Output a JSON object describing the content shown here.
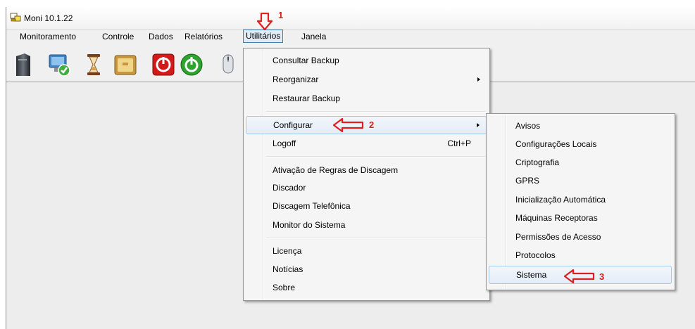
{
  "window": {
    "title": "Moni 10.1.22"
  },
  "menubar": {
    "items": [
      "Monitoramento",
      "Controle",
      "Dados",
      "Relatórios",
      "Utilitários",
      "Janela"
    ],
    "active": "Utilitários"
  },
  "toolbar": {
    "buttons": [
      "server-icon",
      "monitor-check-icon",
      "hourglass-icon",
      "folder-icon",
      "stop-icon",
      "power-icon",
      "mouse-icon"
    ]
  },
  "utilitarios_menu": {
    "items": [
      {
        "label": "Consultar Backup"
      },
      {
        "label": "Reorganizar",
        "submenu": true
      },
      {
        "label": "Restaurar Backup"
      },
      {
        "label": "Configurar",
        "submenu": true,
        "highlighted": true
      },
      {
        "label": "Logoff",
        "shortcut": "Ctrl+P"
      },
      {
        "label": "Ativação de Regras de Discagem"
      },
      {
        "label": "Discador"
      },
      {
        "label": "Discagem Telefônica"
      },
      {
        "label": "Monitor do Sistema"
      },
      {
        "label": "Licença"
      },
      {
        "label": "Notícias"
      },
      {
        "label": "Sobre"
      }
    ]
  },
  "configurar_submenu": {
    "items": [
      {
        "label": "Avisos"
      },
      {
        "label": "Configurações Locais"
      },
      {
        "label": "Criptografia"
      },
      {
        "label": "GPRS"
      },
      {
        "label": "Inicialização Automática"
      },
      {
        "label": "Máquinas Receptoras"
      },
      {
        "label": "Permissões de Acesso"
      },
      {
        "label": "Protocolos"
      },
      {
        "label": "Sistema",
        "highlighted": true
      }
    ]
  },
  "annotations": {
    "step1": "1",
    "step2": "2",
    "step3": "3",
    "color": "#e01e1e"
  }
}
